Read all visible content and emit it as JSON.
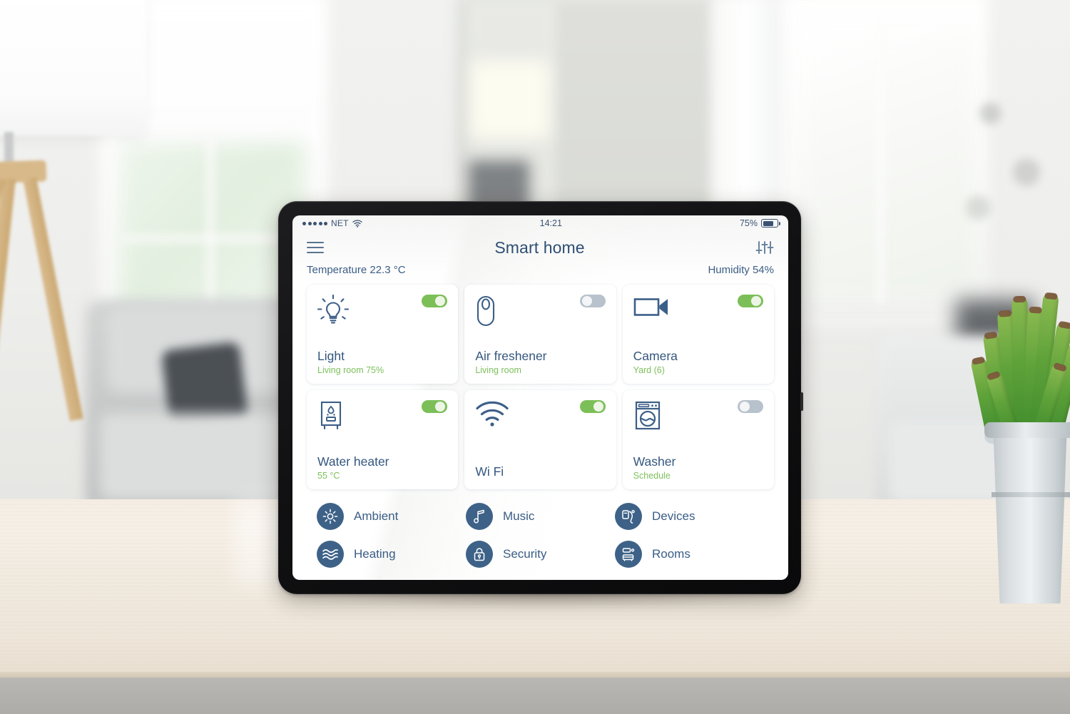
{
  "status_bar": {
    "carrier": "NET",
    "signal_dots": 5,
    "wifi_icon": "wifi-icon",
    "time": "14:21",
    "battery_percent": "75%",
    "battery_level": 75
  },
  "app_bar": {
    "menu_icon": "hamburger-menu-icon",
    "title": "Smart home",
    "settings_icon": "sliders-icon"
  },
  "environment": {
    "temperature": "Temperature 22.3 °C",
    "humidity": "Humidity 54%"
  },
  "colors": {
    "navy": "#34567e",
    "icon_navy": "#3c5f87",
    "green": "#7dc05c",
    "toggle_on": "#7cbf58",
    "toggle_off": "#b8c2cc",
    "nav_circle": "#3e6287",
    "card_bg": "#ffffff",
    "screen_bg": "#ffffff",
    "bezel": "#111113"
  },
  "cards": [
    {
      "icon": "lightbulb-icon",
      "name": "Light",
      "sub": "Living room 75%",
      "toggle": "on"
    },
    {
      "icon": "air-freshener-icon",
      "name": "Air freshener",
      "sub": "Living room",
      "toggle": "off"
    },
    {
      "icon": "video-camera-icon",
      "name": "Camera",
      "sub": "Yard (6)",
      "toggle": "on"
    },
    {
      "icon": "water-heater-icon",
      "name": "Water heater",
      "sub": "55 °C",
      "toggle": "on"
    },
    {
      "icon": "wifi-icon",
      "name": "Wi Fi",
      "sub": "",
      "toggle": "on"
    },
    {
      "icon": "washing-machine-icon",
      "name": "Washer",
      "sub": "Schedule",
      "toggle": "off"
    }
  ],
  "nav": [
    {
      "icon": "sun-icon",
      "label": "Ambient"
    },
    {
      "icon": "music-icon",
      "label": "Music"
    },
    {
      "icon": "devices-icon",
      "label": "Devices"
    },
    {
      "icon": "waves-icon",
      "label": "Heating"
    },
    {
      "icon": "lock-icon",
      "label": "Security"
    },
    {
      "icon": "rooms-icon",
      "label": "Rooms"
    }
  ]
}
